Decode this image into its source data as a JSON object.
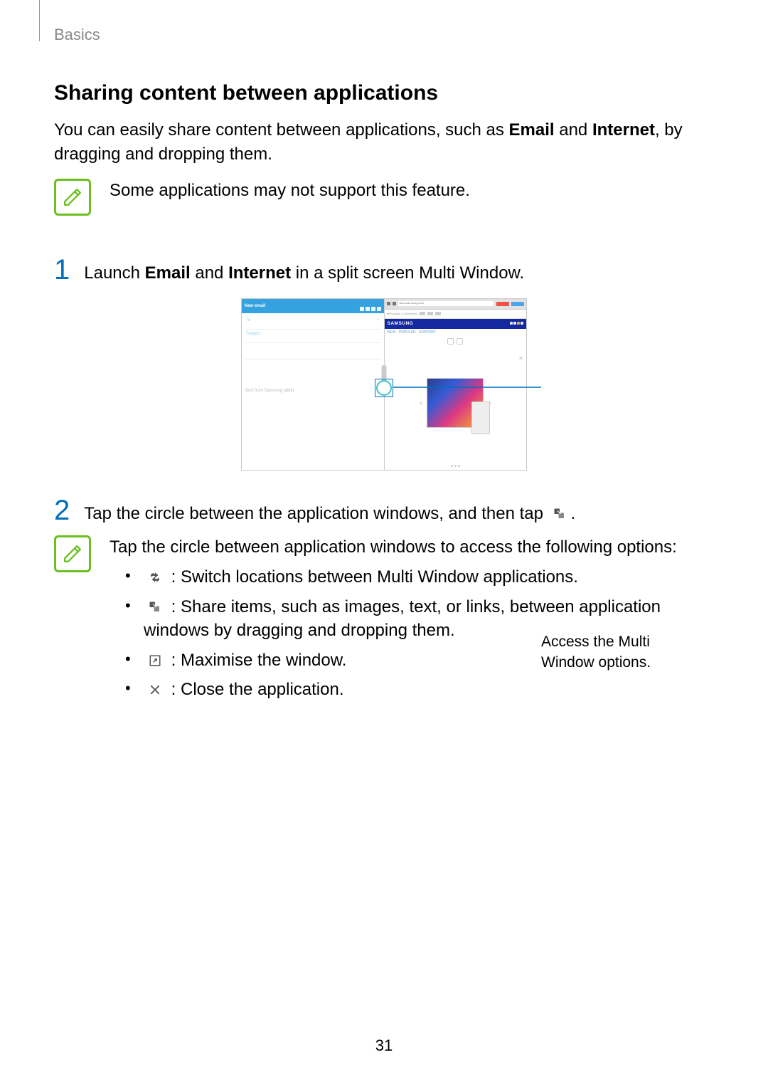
{
  "breadcrumb": "Basics",
  "heading": "Sharing content between applications",
  "intro_pre": "You can easily share content between applications, such as ",
  "intro_b1": "Email",
  "intro_mid": " and ",
  "intro_b2": "Internet",
  "intro_post": ", by dragging and dropping them.",
  "top_note": "Some applications may not support this feature.",
  "step1_num": "1",
  "step1_pre": "Launch ",
  "step1_b1": "Email",
  "step1_mid": " and ",
  "step1_b2": "Internet",
  "step1_post": " in a split screen Multi Window.",
  "callout": "Access the Multi Window options.",
  "step2_num": "2",
  "step2_pre": "Tap the circle between the application windows, and then tap ",
  "step2_post": ".",
  "note_lead": "Tap the circle between application windows to access the following options:",
  "opt_switch": " : Switch locations between Multi Window applications.",
  "opt_share": " : Share items, such as images, text, or links, between application windows by dragging and dropping them.",
  "opt_max": " : Maximise the window.",
  "opt_close": " : Close the application.",
  "page_number": "31",
  "figure": {
    "email_title": "New email",
    "to_label": "To",
    "subject_label": "Subject",
    "attach_label": "Sent from Samsung tablet",
    "url": "www.samsung.com",
    "brand": "SAMSUNG",
    "subnav": "NEW · POPULAR · SUPPORT"
  }
}
